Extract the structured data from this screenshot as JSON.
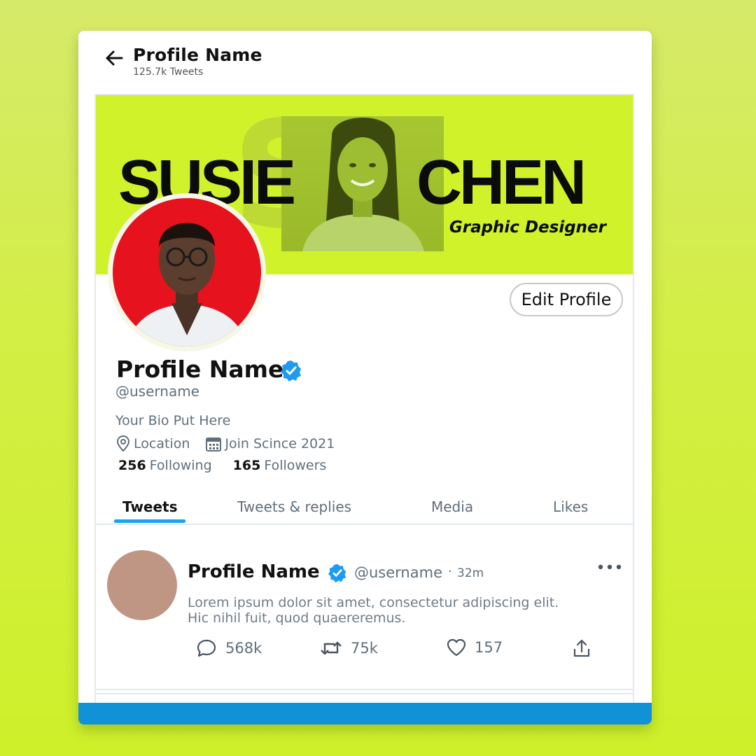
{
  "header": {
    "title": "Profile Name",
    "subtitle": "125.7k Tweets"
  },
  "banner": {
    "first_name": "SUSIE",
    "last_name": "CHEN",
    "role": "Graphic Designer",
    "ghost_text": "SC"
  },
  "profile": {
    "edit_label": "Edit Profile",
    "name": "Profile Name",
    "handle": "@username",
    "bio": "Your Bio Put Here",
    "location": "Location",
    "joined": "Join Scince 2021",
    "following_count": "256",
    "following_label": "Following",
    "followers_count": "165",
    "followers_label": "Followers"
  },
  "tabs": [
    {
      "label": "Tweets",
      "active": true
    },
    {
      "label": "Tweets & replies",
      "active": false
    },
    {
      "label": "Media",
      "active": false
    },
    {
      "label": "Likes",
      "active": false
    }
  ],
  "tweet": {
    "name": "Profile Name",
    "handle": "@username",
    "separator": "·",
    "time": "32m",
    "text_line1": "Lorem ipsum dolor sit amet, consectetur adipiscing elit.",
    "text_line2": "Hic nihil fuit, quod quaereremus.",
    "replies": "568k",
    "retweets": "75k",
    "likes": "157"
  },
  "colors": {
    "background": "#d3ee44",
    "banner": "#cff22a",
    "accent_blue": "#1da1f2",
    "bottom_bar": "#1191d6",
    "avatar_bg": "#e6121e",
    "tweet_avatar": "#bf9583"
  },
  "icons": [
    "arrow-left-icon",
    "verified-badge-icon",
    "location-pin-icon",
    "calendar-icon",
    "more-dots-icon",
    "reply-icon",
    "retweet-icon",
    "like-icon",
    "share-icon"
  ]
}
